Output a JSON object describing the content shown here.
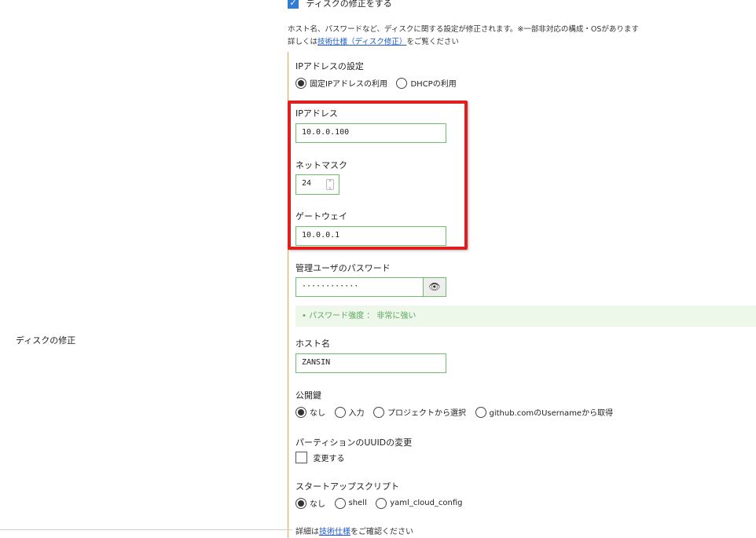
{
  "disk_edit": {
    "section_label": "ディスクの修正",
    "checkbox_label": "ディスクの修正をする",
    "description_line1": "ホスト名、パスワードなど、ディスクに関する設定が修正されます。※一部非対応の構成・OSがあります",
    "description_prefix": "詳しくは",
    "description_link": "技術仕様（ディスク修正）",
    "description_suffix": "をご覧ください"
  },
  "ip_settings": {
    "title": "IPアドレスの設定",
    "options": [
      "固定IPアドレスの利用",
      "DHCPの利用"
    ],
    "selected": "固定IPアドレスの利用"
  },
  "ip_address": {
    "label": "IPアドレス",
    "value": "10.0.0.100"
  },
  "netmask": {
    "label": "ネットマスク",
    "value": "24"
  },
  "gateway": {
    "label": "ゲートウェイ",
    "value": "10.0.0.1"
  },
  "admin_password": {
    "label": "管理ユーザのパスワード",
    "masked_value": "············",
    "strength_text": "• パスワード強度 ： 非常に強い"
  },
  "hostname": {
    "label": "ホスト名",
    "value": "ZANSIN"
  },
  "public_key": {
    "label": "公開鍵",
    "options": [
      "なし",
      "入力",
      "プロジェクトから選択",
      "github.comのUsernameから取得"
    ],
    "selected": "なし"
  },
  "partition_uuid": {
    "label": "パーティションのUUIDの変更",
    "checkbox_label": "変更する"
  },
  "startup_script": {
    "label": "スタートアップスクリプト",
    "options": [
      "なし",
      "shell",
      "yaml_cloud_config"
    ],
    "selected": "なし"
  },
  "footer": {
    "prefix": "詳細は",
    "link": "技術仕様",
    "suffix": "をご確認ください"
  },
  "colors": {
    "highlight": "#e11d1d",
    "accent_line": "#f0a24a",
    "valid_border": "#6bbf6b",
    "link": "#1a57c9"
  },
  "icons": {
    "eye": "eye-icon",
    "check": "check-icon"
  }
}
